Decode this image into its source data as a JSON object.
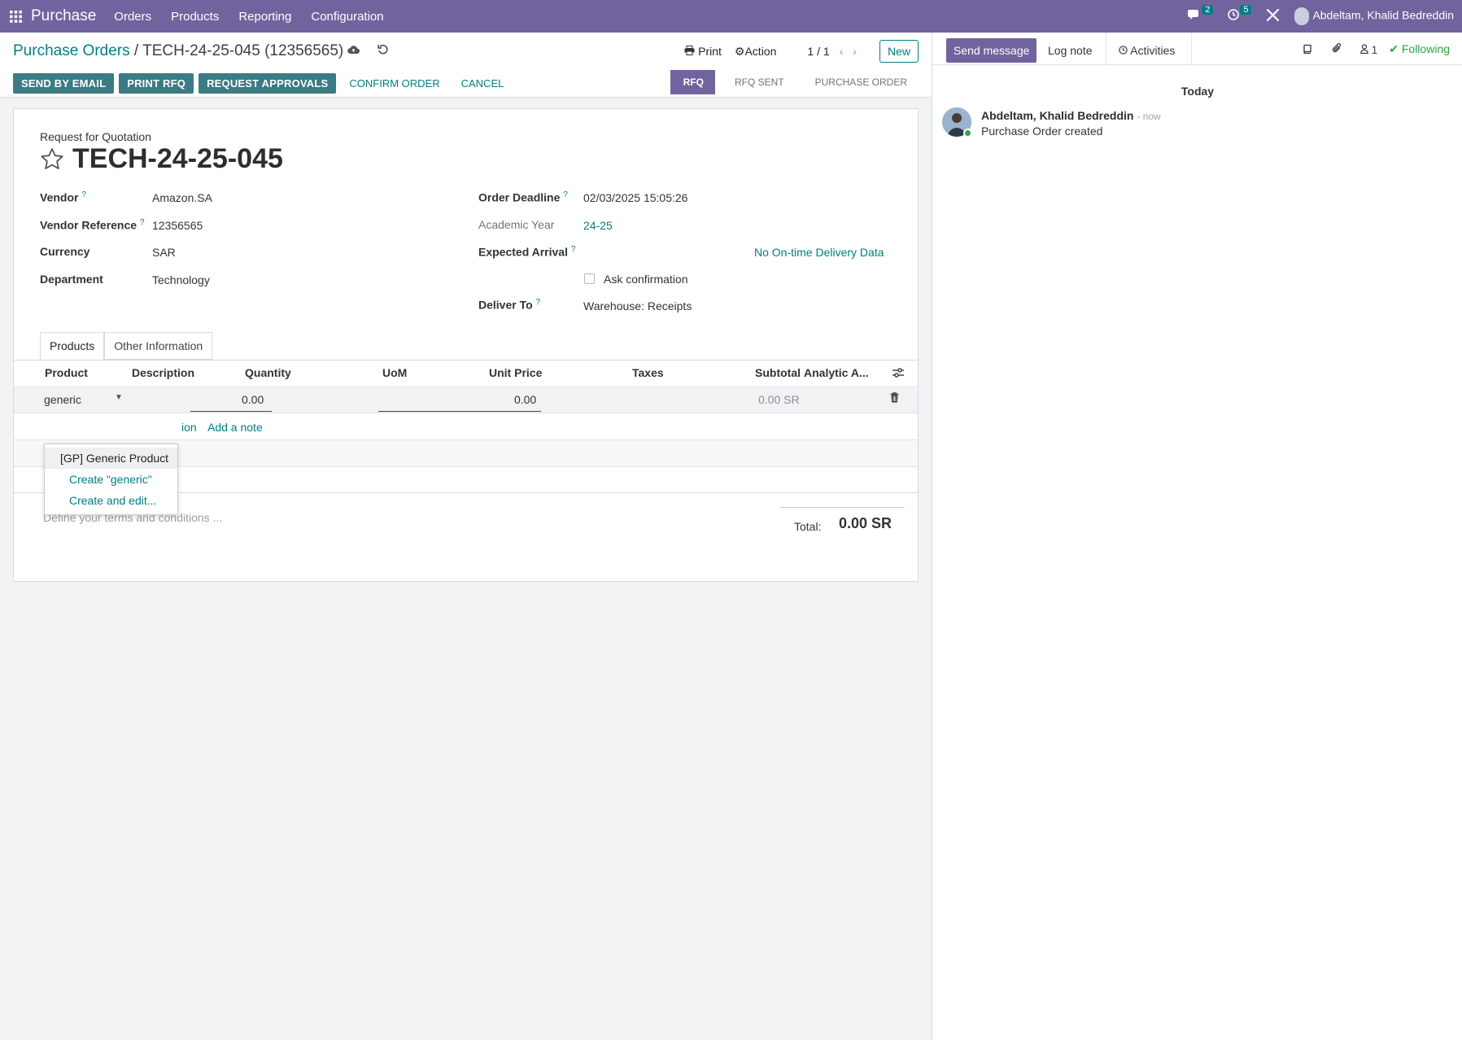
{
  "navbar": {
    "app_name": "Purchase",
    "menus": [
      "Orders",
      "Products",
      "Reporting",
      "Configuration"
    ],
    "messages_count": "2",
    "activities_count": "5",
    "user_name": "Abdeltam, Khalid Bedreddin"
  },
  "breadcrumb": {
    "parent": "Purchase Orders",
    "separator": "/",
    "current": "TECH-24-25-045 (12356565)"
  },
  "control": {
    "print_label": "Print",
    "action_label": "Action",
    "pager": "1 / 1",
    "new_label": "New"
  },
  "actions": {
    "send_email": "SEND BY EMAIL",
    "print_rfq": "PRINT RFQ",
    "request_approvals": "REQUEST APPROVALS",
    "confirm_order": "CONFIRM ORDER",
    "cancel": "CANCEL"
  },
  "status": {
    "steps": [
      "RFQ",
      "RFQ SENT",
      "PURCHASE ORDER"
    ],
    "active": "RFQ"
  },
  "form": {
    "subtitle": "Request for Quotation",
    "name": "TECH-24-25-045",
    "vendor_label": "Vendor",
    "vendor": "Amazon.SA",
    "vendor_ref_label": "Vendor Reference",
    "vendor_ref": "12356565",
    "currency_label": "Currency",
    "currency": "SAR",
    "department_label": "Department",
    "department": "Technology",
    "order_deadline_label": "Order Deadline",
    "order_deadline": "02/03/2025 15:05:26",
    "academic_year_label": "Academic Year",
    "academic_year": "24-25",
    "expected_arrival_label": "Expected Arrival",
    "no_delivery_data": "No On-time Delivery Data",
    "ask_confirmation": "Ask confirmation",
    "deliver_to_label": "Deliver To",
    "deliver_to": "Warehouse: Receipts",
    "help_mark": "?"
  },
  "tabs": [
    "Products",
    "Other Information"
  ],
  "table": {
    "columns": [
      "Product",
      "Description",
      "Quantity",
      "UoM",
      "Unit Price",
      "Taxes",
      "Subtotal",
      "Analytic A..."
    ],
    "row": {
      "product": "generic",
      "quantity": "0.00",
      "unit_price": "0.00",
      "subtotal": "0.00 SR"
    },
    "add_section_partial": "ion",
    "add_note": "Add a note"
  },
  "dropdown": {
    "items": [
      "[GP] Generic Product",
      "Create \"generic\"",
      "Create and edit..."
    ]
  },
  "footer": {
    "terms_placeholder": "Define your terms and conditions ...",
    "total_label": "Total:",
    "total_value": "0.00 SR"
  },
  "chatter": {
    "send_message": "Send message",
    "log_note": "Log note",
    "activities": "Activities",
    "followers_count": "1",
    "following": "Following",
    "day_label": "Today",
    "message": {
      "author": "Abdeltam, Khalid Bedreddin",
      "time": "- now",
      "body": "Purchase Order created"
    }
  },
  "colors": {
    "brand": "#71639e",
    "accent": "#017e84",
    "primary_button": "#3b7b83",
    "following": "#28a745"
  }
}
